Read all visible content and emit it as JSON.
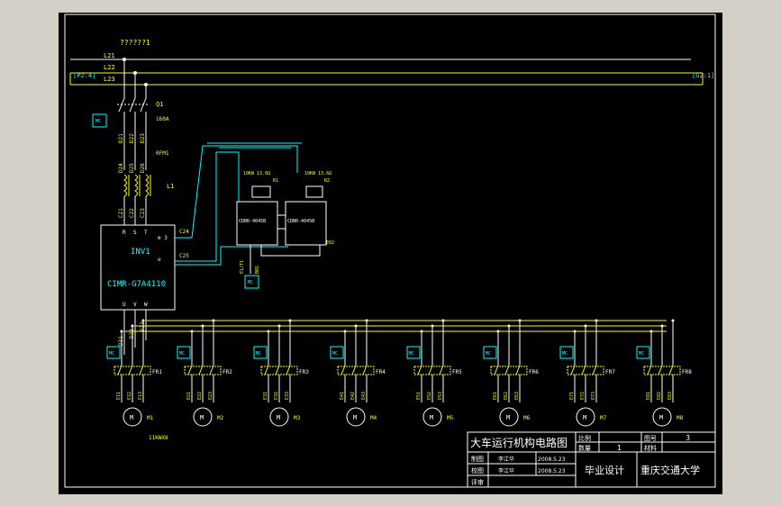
{
  "colors": {
    "background": "#000000",
    "frame": "#ffffff",
    "bus_line": "#ffff00",
    "wire": "#ffffff",
    "wire_cyan": "#00ffff",
    "label": "#ffff00",
    "device_text": "#00ffff",
    "coil": "#ffff00"
  },
  "bus": {
    "title": "??????1",
    "lines": [
      "L21",
      "L22",
      "L23"
    ],
    "left_ref": "[P2:4]",
    "right_ref": "[G2:1]"
  },
  "breaker": {
    "name": "Q1",
    "rating": "160A"
  },
  "wires_top": [
    "D21",
    "D22",
    "D23"
  ],
  "wires_mid": [
    "D24",
    "D25",
    "D26"
  ],
  "reactor": {
    "name": "L1",
    "model": "0FM1"
  },
  "wires_in": [
    "C21",
    "C22",
    "C23"
  ],
  "inverter": {
    "name": "INV1",
    "model": "CIMR-G7A4110",
    "terminals_in": [
      "R",
      "S",
      "T"
    ],
    "terminals_out": [
      "U",
      "V",
      "W"
    ],
    "terminal_plus": "⊕ 3",
    "terminal_minus": "⊖",
    "c24": "C24",
    "c25": "C25"
  },
  "brake_units": [
    {
      "model": "CDBR-4045B",
      "resistor": "RD",
      "tag": "R1",
      "label_top": "10KW   13.6Ω"
    },
    {
      "model": "CDBR-4045B",
      "resistor": "RD",
      "tag": "R2",
      "label_top": "10KW   13.6Ω"
    }
  ],
  "brake_misc": {
    "a": "E1/T1",
    "b": "E1/T2",
    "c": "C24",
    "d": "B01",
    "e": "E02"
  },
  "small_boxes": [
    "MC",
    "MC",
    "MC",
    "MC",
    "MC",
    "MC",
    "MC",
    "MC",
    "MC",
    "MC",
    "MC",
    "MC"
  ],
  "wires_out": [
    "D31",
    "D32",
    "D33"
  ],
  "motors": [
    {
      "label": "M1",
      "relay": "FR1",
      "wires": [
        "E11",
        "E12",
        "E13"
      ]
    },
    {
      "label": "M2",
      "relay": "FR2",
      "wires": [
        "E21",
        "E22",
        "E23"
      ]
    },
    {
      "label": "M3",
      "relay": "FR3",
      "wires": [
        "E31",
        "E32",
        "E33"
      ]
    },
    {
      "label": "M4",
      "relay": "FR4",
      "wires": [
        "E41",
        "E42",
        "E43"
      ]
    },
    {
      "label": "M5",
      "relay": "FR5",
      "wires": [
        "E51",
        "E52",
        "E53"
      ]
    },
    {
      "label": "M6",
      "relay": "FR6",
      "wires": [
        "E61",
        "E62",
        "E63"
      ]
    },
    {
      "label": "M7",
      "relay": "FR7",
      "wires": [
        "E71",
        "E72",
        "E73"
      ]
    },
    {
      "label": "M8",
      "relay": "FR8",
      "wires": [
        "E81",
        "E82",
        "E83"
      ]
    }
  ],
  "motor_symbol": "M",
  "motor_power": "11KWX8",
  "title_block": {
    "title": "大车运行机构电路图",
    "scale_label": "比例",
    "qty_label": "数量",
    "qty_value": "1",
    "drawing_no_label": "图号",
    "drawing_no_value": "3",
    "material_label": "材料",
    "drawn_label": "制图",
    "drawn_name": "李江华",
    "drawn_date": "2008.5.23",
    "checked_label": "校图",
    "checked_name": "李江华",
    "checked_date": "2008.5.23",
    "review_label": "评审",
    "project": "毕业设计",
    "school": "重庆交通大学"
  }
}
